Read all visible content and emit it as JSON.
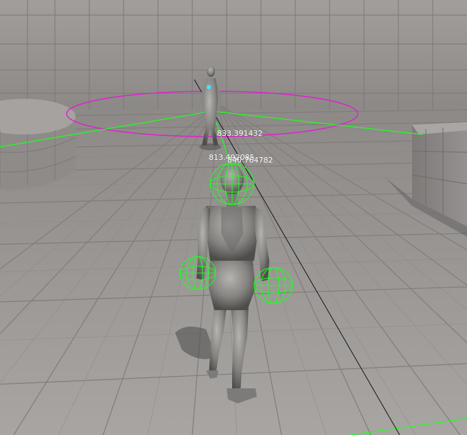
{
  "viewport": {
    "debug_labels": [
      "833.391432",
      "813.492085",
      "840.764782"
    ]
  },
  "colors": {
    "floor": "#9b9896",
    "floor_grid": "#7f7c7a",
    "wall": "#9a9795",
    "wall_grid": "#777472",
    "mannequin": "#8a8885",
    "mannequin_shadow": "#4c4a49",
    "debug_green": "#20ff20",
    "debug_magenta": "#e020d0",
    "trace_black": "#111111"
  },
  "icons": {
    "target_marker": "cyan-head-icon"
  }
}
